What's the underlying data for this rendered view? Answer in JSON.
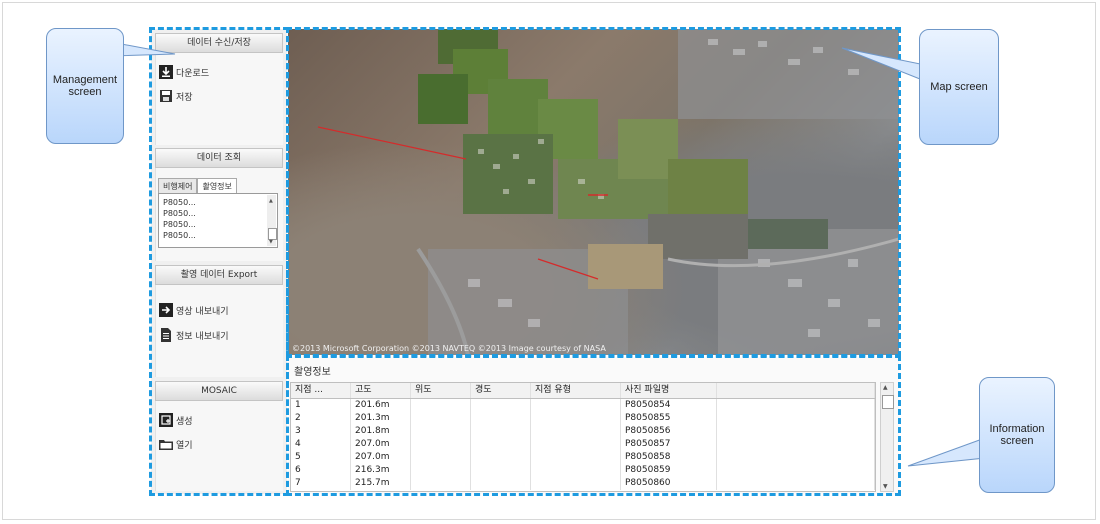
{
  "callouts": {
    "management": "Management screen",
    "map": "Map screen",
    "information": "Information screen"
  },
  "sidebar": {
    "sections": [
      {
        "title": "데이터 수신/저장",
        "items": [
          {
            "label": "다운로드",
            "icon": "download-icon"
          },
          {
            "label": "저장",
            "icon": "save-icon"
          }
        ]
      },
      {
        "title": "데이터 조회",
        "tabs": [
          "비행제어",
          "촬영정보"
        ],
        "active_tab": 1,
        "list": [
          "P8050...",
          "P8050...",
          "P8050...",
          "P8050..."
        ]
      },
      {
        "title": "촬영 데이터 Export",
        "items": [
          {
            "label": "영상 내보내기",
            "icon": "export-image-icon"
          },
          {
            "label": "정보 내보내기",
            "icon": "export-document-icon"
          }
        ]
      },
      {
        "title": "MOSAIC",
        "items": [
          {
            "label": "생성",
            "icon": "create-icon"
          },
          {
            "label": "열기",
            "icon": "open-folder-icon"
          }
        ]
      }
    ]
  },
  "map": {
    "copyright": "©2013 Microsoft Corporation  ©2013 NAVTEQ  ©2013 Image courtesy of NASA"
  },
  "info": {
    "title": "촬영정보",
    "columns": [
      "지점 ...",
      "고도",
      "위도",
      "경도",
      "지점 유형",
      "사진 파일명"
    ],
    "rows": [
      [
        "1",
        "201.6m",
        "",
        "",
        "",
        "P8050854"
      ],
      [
        "2",
        "201.3m",
        "",
        "",
        "",
        "P8050855"
      ],
      [
        "3",
        "201.8m",
        "",
        "",
        "",
        "P8050856"
      ],
      [
        "4",
        "207.0m",
        "",
        "",
        "",
        "P8050857"
      ],
      [
        "5",
        "207.0m",
        "",
        "",
        "",
        "P8050858"
      ],
      [
        "6",
        "216.3m",
        "",
        "",
        "",
        "P8050859"
      ],
      [
        "7",
        "215.7m",
        "",
        "",
        "",
        "P8050860"
      ]
    ]
  },
  "colors": {
    "dash": "#1e9be0",
    "callout_border": "#6f97c8"
  }
}
